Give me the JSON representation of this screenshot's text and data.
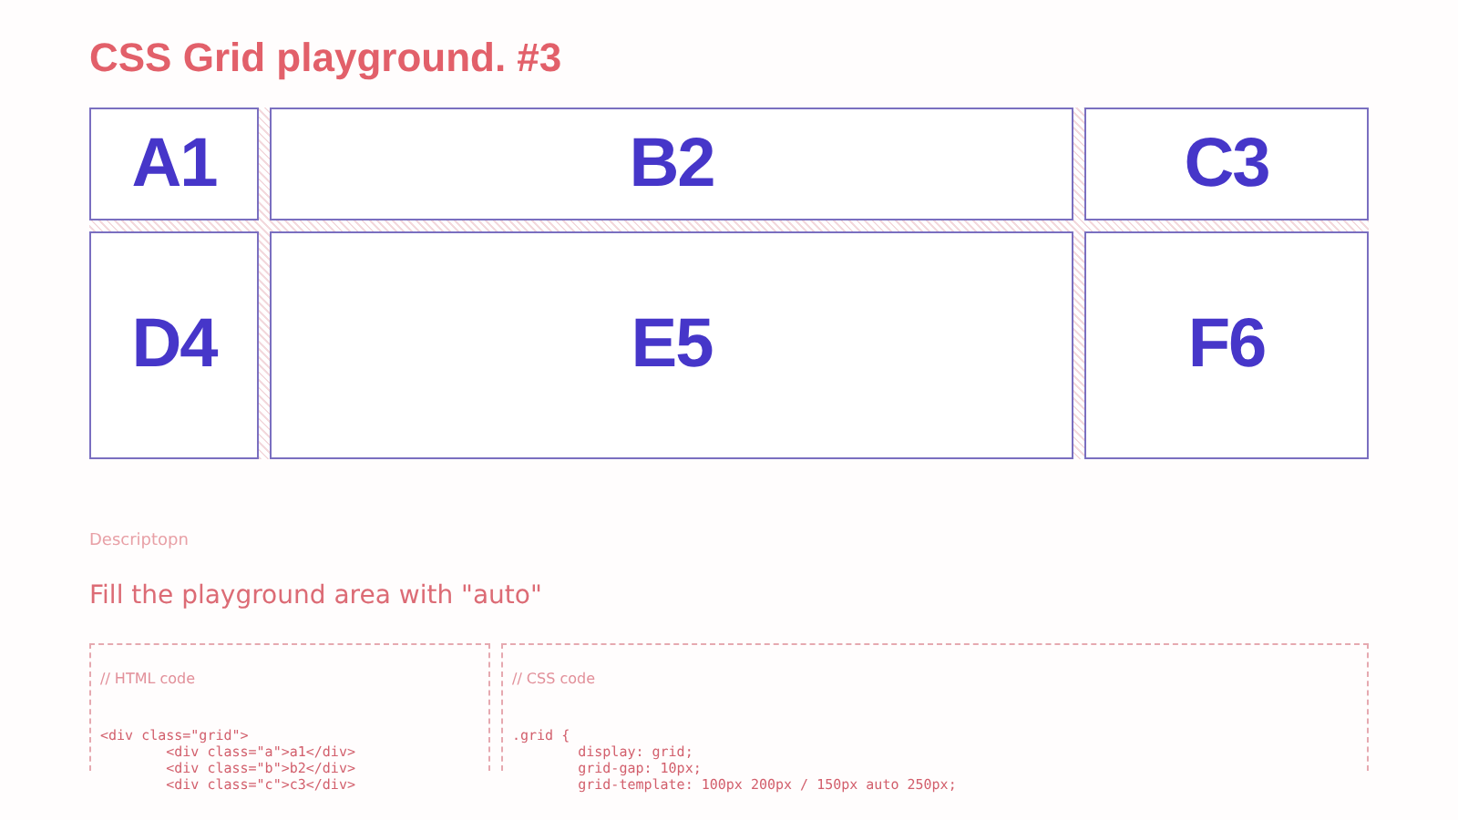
{
  "title": "CSS Grid playground. #3",
  "grid": {
    "cells": [
      "A1",
      "B2",
      "C3",
      "D4",
      "E5",
      "F6"
    ]
  },
  "description": {
    "label": "Descriptopn",
    "text": "Fill the playground area with \"auto\""
  },
  "code_panels": [
    {
      "comment": "// HTML code",
      "lines": [
        "<div class=\"grid\">",
        "        <div class=\"a\">a1</div>",
        "        <div class=\"b\">b2</div>",
        "        <div class=\"c\">c3</div>"
      ]
    },
    {
      "comment": "// CSS code",
      "lines": [
        ".grid {",
        "        display: grid;",
        "        grid-gap: 10px;",
        "        grid-template: 100px 200px / 150px auto 250px;"
      ]
    }
  ]
}
